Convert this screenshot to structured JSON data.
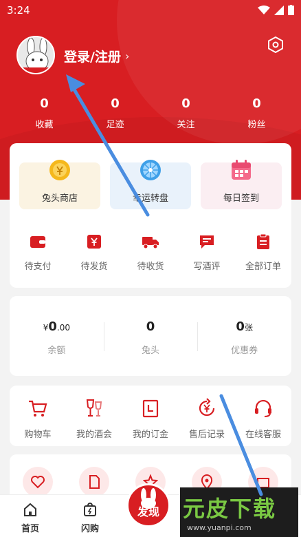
{
  "status": {
    "time": "3:24"
  },
  "profile": {
    "login_label": "登录/注册"
  },
  "stats": [
    {
      "value": "0",
      "label": "收藏"
    },
    {
      "value": "0",
      "label": "足迹"
    },
    {
      "value": "0",
      "label": "关注"
    },
    {
      "value": "0",
      "label": "粉丝"
    }
  ],
  "features": [
    {
      "label": "兔头商店",
      "icon": "coin-icon"
    },
    {
      "label": "幸运转盘",
      "icon": "wheel-icon"
    },
    {
      "label": "每日签到",
      "icon": "calendar-icon"
    }
  ],
  "orders": [
    {
      "label": "待支付",
      "icon": "wallet-icon"
    },
    {
      "label": "待发货",
      "icon": "yen-box-icon"
    },
    {
      "label": "待收货",
      "icon": "truck-icon"
    },
    {
      "label": "写酒评",
      "icon": "comment-icon"
    },
    {
      "label": "全部订单",
      "icon": "clipboard-icon"
    }
  ],
  "assets": {
    "balance_prefix": "¥",
    "balance_main": "0",
    "balance_decimal": ".00",
    "balance_label": "余额",
    "rabbit_value": "0",
    "rabbit_label": "兔头",
    "coupon_value": "0",
    "coupon_unit": "张",
    "coupon_label": "优惠券"
  },
  "tools": [
    {
      "label": "购物车",
      "icon": "cart-icon"
    },
    {
      "label": "我的酒会",
      "icon": "glasses-icon"
    },
    {
      "label": "我的订金",
      "icon": "deposit-icon"
    },
    {
      "label": "售后记录",
      "icon": "refund-icon"
    },
    {
      "label": "在线客服",
      "icon": "headset-icon"
    }
  ],
  "tabbar": {
    "home": "首页",
    "flash": "闪购",
    "discover": "发现"
  },
  "watermark": {
    "title": "元皮下载",
    "url": "www.yuanpi.com"
  },
  "colors": {
    "brand": "#d81e22",
    "watermark_green": "#7ac943"
  }
}
